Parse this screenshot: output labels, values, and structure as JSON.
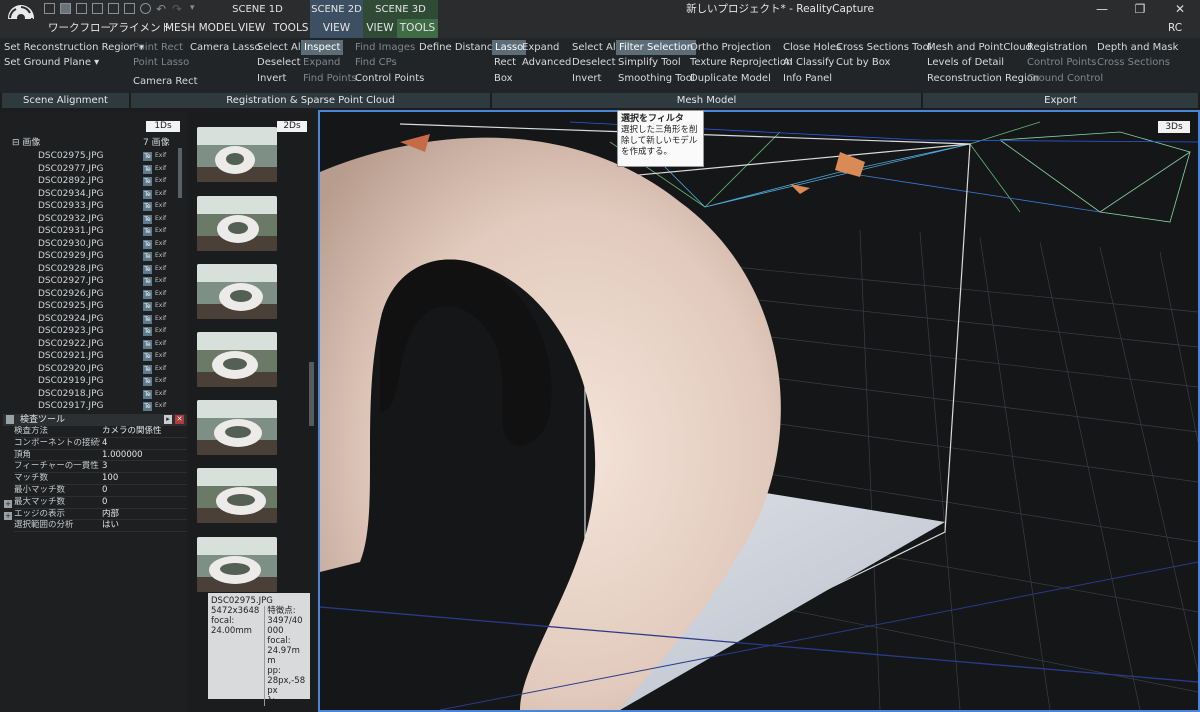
{
  "app": {
    "window_title": "新しいプロジェクト* - RealityCapture",
    "rc_label": "RC",
    "win_controls": {
      "min": "—",
      "max": "❐",
      "close": "✕"
    }
  },
  "scene_tabs": [
    {
      "label": "SCENE 1D"
    },
    {
      "label": "SCENE 2D"
    },
    {
      "label": "SCENE 3D"
    }
  ],
  "menu": [
    "ワークフロー",
    "アライメント",
    "MESH MODEL",
    "VIEW",
    "TOOLS",
    "VIEW",
    "VIEW",
    "TOOLS"
  ],
  "ribbon": {
    "alignment": [
      "Set Reconstruction Region ▾",
      "Set Ground Plane ▾"
    ],
    "sparse_col1": [
      "Point Rect",
      "Point Lasso"
    ],
    "sparse_col2": [
      "Camera Lasso",
      "Camera Rect"
    ],
    "sparse_col3": [
      "Select All",
      "Deselect",
      "Invert"
    ],
    "sparse_col4": [
      "Inspect",
      "Expand",
      "Find Points"
    ],
    "sparse_col5": [
      "Find Images",
      "Find CPs",
      "Control Points"
    ],
    "sparse_col6": [
      "Define Distance"
    ],
    "mesh_col1": [
      "Lasso",
      "Rect",
      "Box"
    ],
    "mesh_col2": [
      "Expand",
      "Advanced"
    ],
    "mesh_col3": [
      "Select All",
      "Deselect",
      "Invert"
    ],
    "mesh_col4": [
      "Filter Selection",
      "Simplify Tool",
      "Smoothing Tool"
    ],
    "mesh_col5": [
      "Ortho Projection",
      "Texture Reprojection",
      "Duplicate Model"
    ],
    "mesh_col6": [
      "Close Holes",
      "AI Classify",
      "Info Panel"
    ],
    "mesh_col7": [
      "Cross Sections Tool",
      "Cut by Box"
    ],
    "export_col1": [
      "Mesh and PointCloud",
      "Levels of Detail",
      "Reconstruction Region"
    ],
    "export_col2": [
      "Registration",
      "Control Points",
      "Ground Control"
    ],
    "export_col3": [
      "Depth and Mask",
      "Cross Sections"
    ]
  },
  "groups": [
    "Scene Alignment",
    "Registration & Sparse Point Cloud",
    "Mesh Model",
    "Export"
  ],
  "left": {
    "panel_1ds": "1Ds",
    "root_label": "画像",
    "image_count": "7 画像",
    "files": [
      "DSC02975.JPG",
      "DSC02977.JPG",
      "DSC02892.JPG",
      "DSC02934.JPG",
      "DSC02933.JPG",
      "DSC02932.JPG",
      "DSC02931.JPG",
      "DSC02930.JPG",
      "DSC02929.JPG",
      "DSC02928.JPG",
      "DSC02927.JPG",
      "DSC02926.JPG",
      "DSC02925.JPG",
      "DSC02924.JPG",
      "DSC02923.JPG",
      "DSC02922.JPG",
      "DSC02921.JPG",
      "DSC02920.JPG",
      "DSC02919.JPG",
      "DSC02918.JPG",
      "DSC02917.JPG"
    ],
    "badge_te": "Te",
    "badge_exif": "Exif"
  },
  "inspector": {
    "title": "検査ツール",
    "rows": [
      {
        "k": "検査方法",
        "v": "カメラの関係性"
      },
      {
        "k": "コンポーネントの接続性",
        "v": "4"
      },
      {
        "k": "頂角",
        "v": "1.000000"
      },
      {
        "k": "フィーチャーの一貫性",
        "v": "3"
      },
      {
        "k": "マッチ数",
        "v": "100"
      },
      {
        "k": "最小マッチ数",
        "v": "0"
      },
      {
        "k": "最大マッチ数",
        "v": "0"
      },
      {
        "k": "エッジの表示",
        "v": "内部"
      },
      {
        "k": "選択範囲の分析",
        "v": "はい"
      }
    ]
  },
  "panel_2ds": "2Ds",
  "panel_3ds": "3Ds",
  "tooltip_image": {
    "filename": "DSC02975.JPG",
    "size": "5472x3648",
    "focal_label": "focal:",
    "focal_value": "24.00mm",
    "feat_label": "特徴点:",
    "feat_value": "3497/40000",
    "focal2_label": "focal:",
    "focal2_value": "24.97mm",
    "pp_label": "pp:",
    "pp_value": "28px,-58px",
    "lambda_label": "λ:"
  },
  "tooltip_filter": {
    "title": "選択をフィルタ",
    "body": "選択した三角形を削除して新しいモデルを作成する。"
  },
  "colors": {
    "accent": "#4a86d8",
    "ribbon_sel": "#5d6d78",
    "scene3d_tab": "#3f6b45",
    "scene2d_tab": "#3c4f63"
  }
}
